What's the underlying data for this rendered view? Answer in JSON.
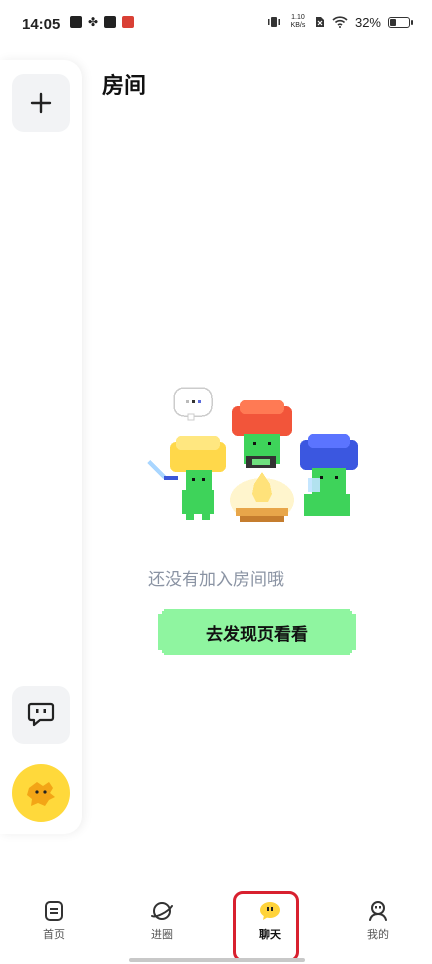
{
  "status_bar": {
    "time": "14:05",
    "net_speed_value": "1.10",
    "net_speed_unit": "KB/s",
    "battery": "32%",
    "battery_level": 0.32
  },
  "page": {
    "title": "房间"
  },
  "empty_state": {
    "message": "还没有加入房间哦",
    "button_label": "去发现页看看"
  },
  "nav": {
    "items": [
      {
        "label": "首页",
        "icon": "home-doc-icon"
      },
      {
        "label": "进圈",
        "icon": "planet-icon"
      },
      {
        "label": "聊天",
        "icon": "chat-bubble-icon",
        "active": true
      },
      {
        "label": "我的",
        "icon": "profile-icon"
      }
    ]
  },
  "colors": {
    "accent_green": "#8ff5a0",
    "avatar_yellow": "#ffd93b",
    "highlight_red": "#d8202f"
  }
}
